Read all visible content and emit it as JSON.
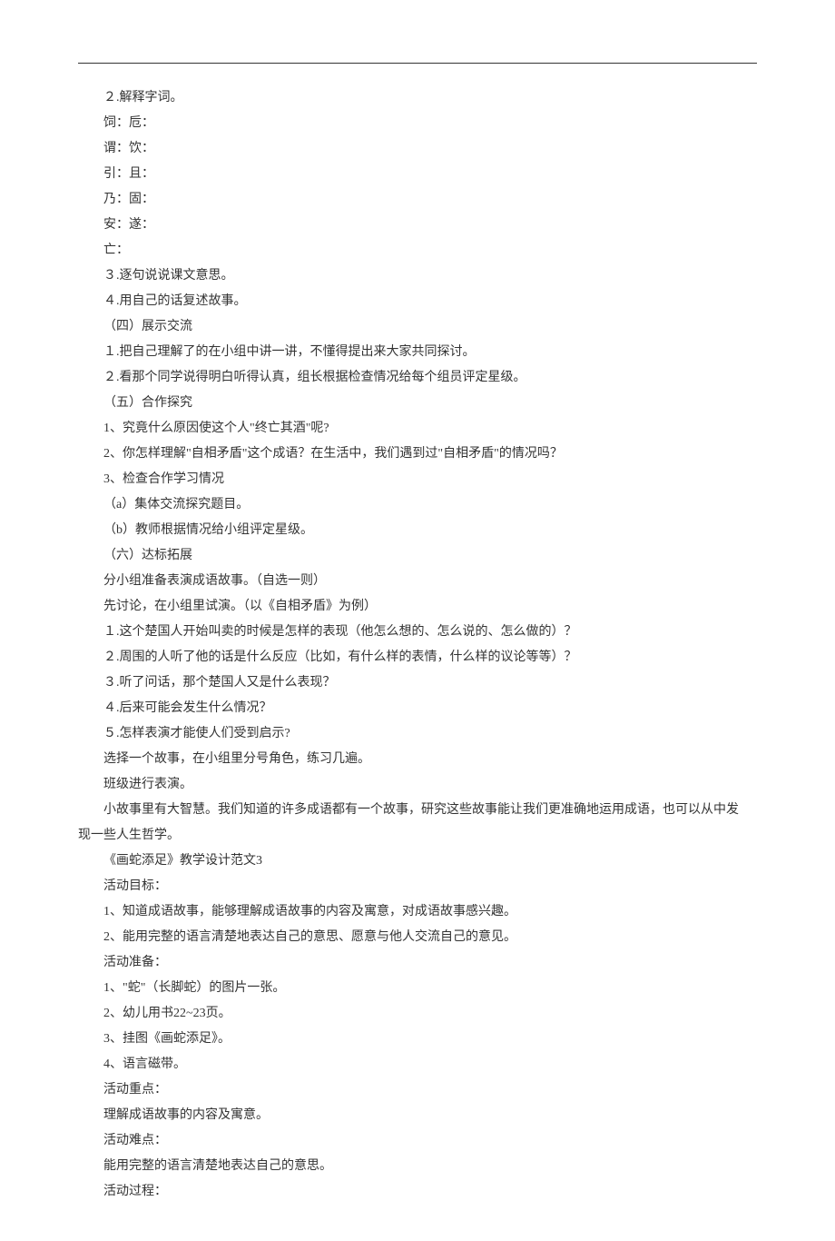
{
  "lines": [
    "２.解释字词。",
    "饲：卮：",
    "谓：饮：",
    "引：且：",
    "乃：固：",
    "安：遂：",
    "亡：",
    "３.逐句说说课文意思。",
    "４.用自己的话复述故事。",
    "（四）展示交流",
    "１.把自己理解了的在小组中讲一讲，不懂得提出来大家共同探讨。",
    "２.看那个同学说得明白听得认真，组长根据检查情况给每个组员评定星级。",
    "（五）合作探究",
    "1、究竟什么原因使这个人\"终亡其酒\"呢?",
    "2、你怎样理解\"自相矛盾\"这个成语？在生活中，我们遇到过\"自相矛盾\"的情况吗？",
    "3、检查合作学习情况",
    "（a）集体交流探究题目。",
    "（b）教师根据情况给小组评定星级。",
    "（六）达标拓展",
    "分小组准备表演成语故事。（自选一则）",
    "先讨论，在小组里试演。（以《自相矛盾》为例）",
    "１.这个楚国人开始叫卖的时候是怎样的表现（他怎么想的、怎么说的、怎么做的）？",
    "２.周围的人听了他的话是什么反应（比如，有什么样的表情，什么样的议论等等）？",
    "３.听了问话，那个楚国人又是什么表现？",
    "４.后来可能会发生什么情况？",
    "５.怎样表演才能使人们受到启示?",
    "选择一个故事，在小组里分号角色，练习几遍。",
    "班级进行表演。"
  ],
  "wrapped": {
    "first": "小故事里有大智慧。我们知道的许多成语都有一个故事，研究这些故事能让我们更准确地运用成语，也可以从中发",
    "second": "现一些人生哲学。"
  },
  "lines2": [
    "《画蛇添足》教学设计范文3",
    "活动目标：",
    "1、知道成语故事，能够理解成语故事的内容及寓意，对成语故事感兴趣。",
    "2、能用完整的语言清楚地表达自己的意思、愿意与他人交流自己的意见。",
    "活动准备：",
    "1、\"蛇\"（长脚蛇）的图片一张。",
    "2、幼儿用书22~23页。",
    "3、挂图《画蛇添足》。",
    "4、语言磁带。",
    "活动重点：",
    "理解成语故事的内容及寓意。",
    "活动难点：",
    "能用完整的语言清楚地表达自己的意思。",
    "活动过程："
  ]
}
